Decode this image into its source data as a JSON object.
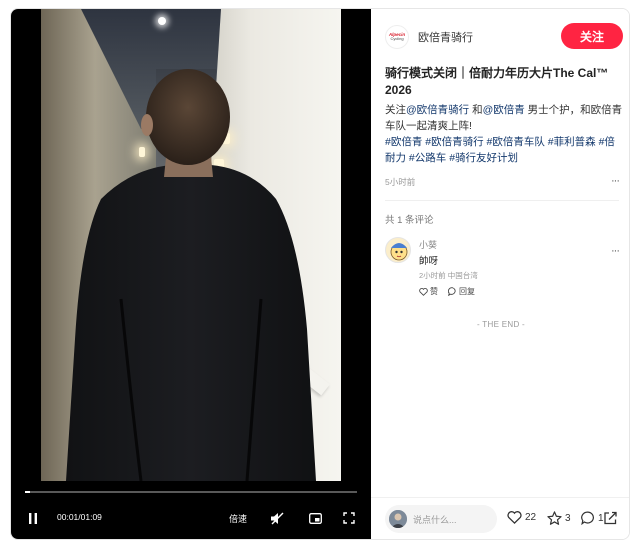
{
  "player": {
    "time": "00:01/01:09",
    "speed_label": "倍速",
    "progress_fraction": 0.015,
    "icons": {
      "play": "pause-icon",
      "volume": "volume-muted-icon",
      "pip": "picture-in-picture-icon",
      "fullscreen": "fullscreen-icon"
    }
  },
  "author": {
    "logo_text_1": "Alpecin",
    "logo_text_2": "Cycling",
    "name": "欧倍青骑行",
    "follow_label": "关注"
  },
  "post": {
    "title": "骑行模式关闭｜倍耐力年历大片The Cal™ 2026",
    "desc_prefix": "关注",
    "mention_1": "@欧倍青骑行",
    "desc_and": " 和",
    "mention_2": "@欧倍青",
    "desc_rest": " 男士个护，和欧倍青车队一起清爽上阵!",
    "tags": [
      "#欧倍青",
      "#欧倍青骑行",
      "#欧倍青车队",
      "#菲利普森",
      "#倍耐力",
      "#公路车",
      "#骑行友好计划"
    ],
    "time_ago": "5小时前",
    "more": "···"
  },
  "comments": {
    "count_label": "共 1 条评论",
    "items": [
      {
        "name": "小葵",
        "text": "帥呀",
        "meta": "2小时前 中国台湾",
        "like_label": "赞",
        "reply_label": "回复",
        "more": "···"
      }
    ],
    "end_label": "- THE END -"
  },
  "bottom": {
    "placeholder": "说点什么...",
    "likes": "22",
    "stars": "3",
    "comments": "1"
  },
  "colors": {
    "accent": "#ff2442",
    "link": "#13386c",
    "video_bg": "#000000"
  }
}
